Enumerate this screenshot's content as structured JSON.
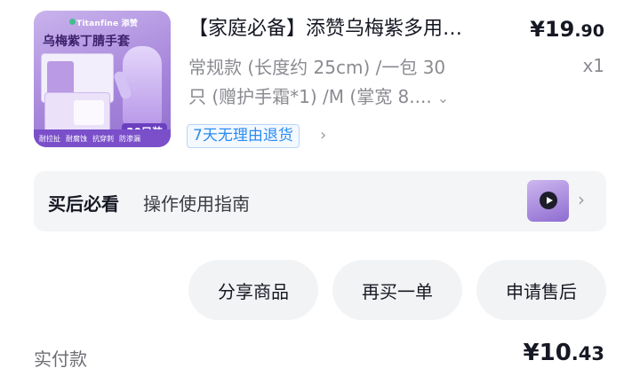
{
  "product": {
    "title": "【家庭必备】添赞乌梅紫多用…",
    "price_currency": "¥",
    "price_int": "19",
    "price_dec": ".90",
    "spec_line1": "常规款 (长度约 25cm) /一包 30",
    "spec_line2": "只 (赠护手霜*1) /M (掌宽 8....",
    "quantity": "x1",
    "return_tag": "7天无理由退货",
    "thumbnail": {
      "brand": "Titanfine 添赞",
      "name": "乌梅紫丁腈手套",
      "count": "30只装",
      "features": [
        "耐拉扯",
        "耐腐蚀",
        "抗穿刺",
        "防渗漏"
      ]
    }
  },
  "guide": {
    "label": "买后必看",
    "text": "操作使用指南"
  },
  "actions": {
    "share": "分享商品",
    "rebuy": "再买一单",
    "after_sale": "申请售后"
  },
  "payment": {
    "label": "实付款",
    "currency": "¥",
    "amount_int": "10",
    "amount_dec": ".43"
  },
  "icons": {
    "chevron_down": "chevron-down-icon",
    "chevron_right": "chevron-right-icon",
    "play": "play-icon"
  },
  "colors": {
    "tag_blue": "#2a8bf0",
    "thumb_purple": "#a888dc",
    "card_bg": "#f4f5f7"
  }
}
